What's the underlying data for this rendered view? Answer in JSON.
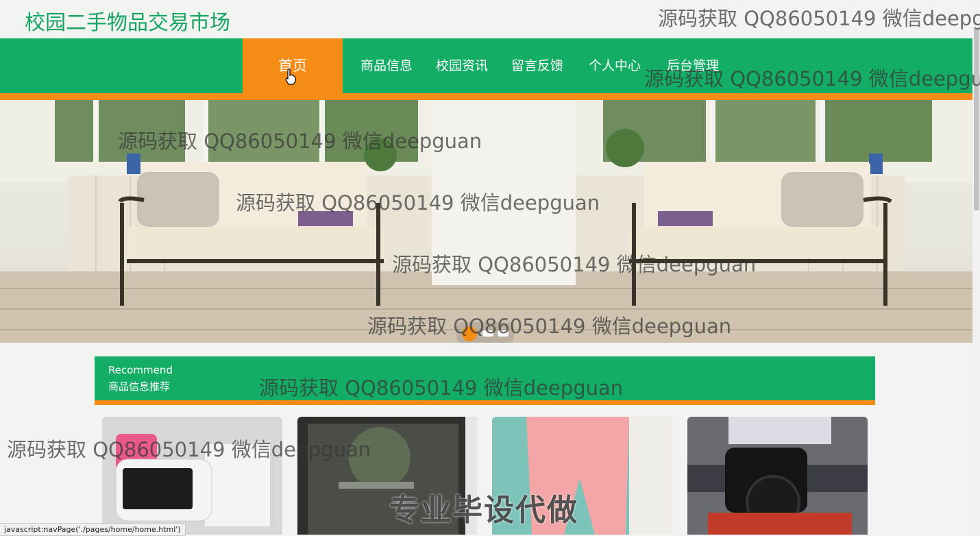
{
  "site": {
    "title": "校园二手物品交易市场"
  },
  "nav": {
    "items": [
      {
        "label": "首页",
        "active": true
      },
      {
        "label": "商品信息"
      },
      {
        "label": "校园资讯"
      },
      {
        "label": "留言反馈"
      },
      {
        "label": "个人中心"
      },
      {
        "label": "后台管理"
      }
    ]
  },
  "carousel": {
    "slide_count": 3,
    "active_index": 0
  },
  "recommend": {
    "title_en": "Recommend",
    "title_cn": "商品信息推荐"
  },
  "watermarks": {
    "text": "源码获取 QQ86050149 微信deepguan",
    "text_cut_top": "源码获取 QQ86050149 微信deepg",
    "text_cut_nav": "源码获取 QQ86050149 微信deepgu",
    "overlay": "专业毕设代做"
  },
  "status_bar": {
    "text": "javascript:navPage('./pages/home/home.html')"
  },
  "colors": {
    "brand_green": "#14ad66",
    "accent_orange": "#f58c16"
  }
}
